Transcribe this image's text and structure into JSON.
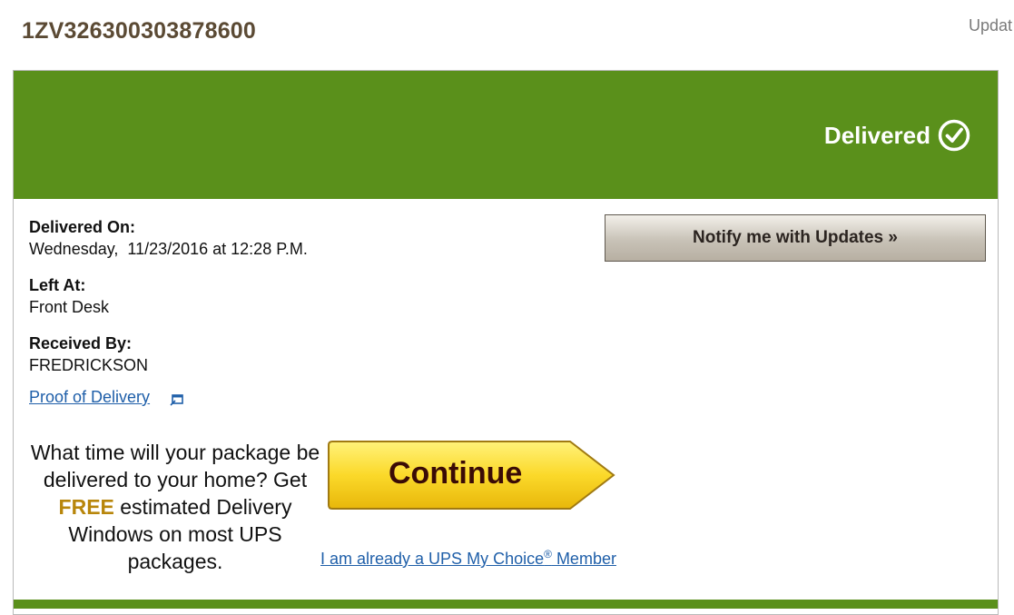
{
  "header": {
    "tracking_number": "1ZV326300303878600",
    "top_right_link": "Updat"
  },
  "status": {
    "label": "Delivered",
    "icon": "check-circle-icon",
    "color": "#5a901b"
  },
  "details": {
    "delivered_on_label": "Delivered On:",
    "delivered_on_value": "Wednesday,  11/23/2016 at 12:28 P.M.",
    "left_at_label": "Left At:",
    "left_at_value": "Front Desk",
    "received_by_label": "Received By:",
    "received_by_value": "FREDRICKSON"
  },
  "proof_of_delivery": {
    "label": "Proof of Delivery",
    "icon": "popup-window-icon"
  },
  "notify": {
    "label": "Notify me with Updates »"
  },
  "promo": {
    "line_before": "What time will your package be delivered to your home? Get ",
    "free": "FREE",
    "line_after": " estimated Delivery Windows on most UPS packages.",
    "continue_label": "Continue",
    "member_link_before": "I am already a UPS My Choice",
    "member_link_reg": "®",
    "member_link_after": " Member"
  }
}
